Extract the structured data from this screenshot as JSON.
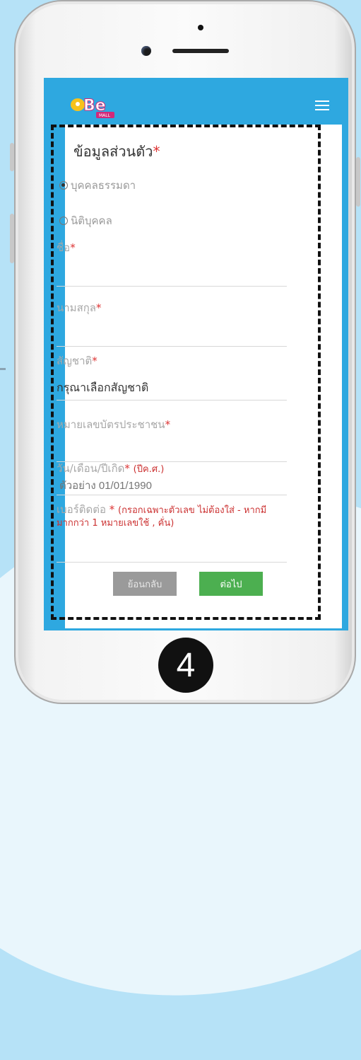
{
  "header": {
    "logo_alt": "BeMall",
    "logo_sub": "MALL"
  },
  "form": {
    "title": "ข้อมูลส่วนตัว",
    "title_required": "*",
    "person_types": [
      {
        "label": "บุคคลธรรมดา",
        "checked": true
      },
      {
        "label": "นิติบุคคล",
        "checked": false
      }
    ],
    "fields": {
      "first_name": {
        "label": "ชื่อ",
        "required": "*"
      },
      "last_name": {
        "label": "นามสกุล",
        "required": "*"
      },
      "nationality": {
        "label": "สัญชาติ",
        "required": "*",
        "value": "กรุณาเลือกสัญชาติ"
      },
      "id_card": {
        "label": "หมายเลขบัตรประชาชน",
        "required": "*"
      },
      "birth_date": {
        "label": "วัน/เดือน/ปีเกิด",
        "required": "*",
        "hint": "(ปีค.ศ.)",
        "placeholder": "ตัวอย่าง 01/01/1990"
      },
      "phone": {
        "label": "เบอร์ติดต่อ",
        "required": "*",
        "hint": "(กรอกเฉพาะตัวเลข ไม่ต้องใส่ - หากมีมากกว่า 1 หมายเลขใช้ , คั่น)"
      }
    },
    "back_button": "ย้อนกลับ",
    "next_button": "ต่อไป"
  },
  "step": {
    "number": "4"
  },
  "colors": {
    "screen_blue": "#2ea8e0",
    "next_green": "#4caf50",
    "required_red": "#d33333"
  }
}
